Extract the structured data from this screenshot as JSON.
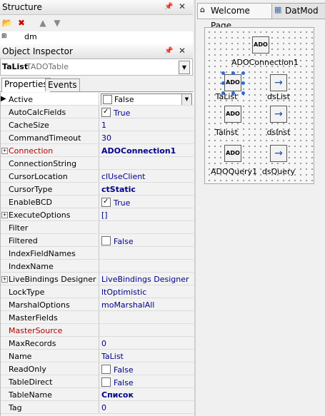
{
  "structure": {
    "title": "Structure",
    "tree_item": "dm"
  },
  "object_inspector": {
    "title": "Object Inspector",
    "selected_name": "TaList",
    "selected_class": "TADOTable",
    "tabs": [
      "Properties",
      "Events"
    ],
    "properties": [
      {
        "name": "Active",
        "value": "False",
        "kind": "combo-check",
        "checked": false
      },
      {
        "name": "AutoCalcFields",
        "value": "True",
        "kind": "check",
        "checked": true
      },
      {
        "name": "CacheSize",
        "value": "1"
      },
      {
        "name": "CommandTimeout",
        "value": "30"
      },
      {
        "name": "Connection",
        "value": "ADOConnection1",
        "expandable": true,
        "name_color": "red",
        "bold_value": true
      },
      {
        "name": "ConnectionString",
        "value": ""
      },
      {
        "name": "CursorLocation",
        "value": "clUseClient"
      },
      {
        "name": "CursorType",
        "value": "ctStatic",
        "bold_value": true
      },
      {
        "name": "EnableBCD",
        "value": "True",
        "kind": "check",
        "checked": true
      },
      {
        "name": "ExecuteOptions",
        "value": "[]",
        "expandable": true
      },
      {
        "name": "Filter",
        "value": ""
      },
      {
        "name": "Filtered",
        "value": "False",
        "kind": "check",
        "checked": false
      },
      {
        "name": "IndexFieldNames",
        "value": ""
      },
      {
        "name": "IndexName",
        "value": ""
      },
      {
        "name": "LiveBindings Designer",
        "value": "LiveBindings Designer",
        "expandable": true
      },
      {
        "name": "LockType",
        "value": "ltOptimistic"
      },
      {
        "name": "MarshalOptions",
        "value": "moMarshalAll"
      },
      {
        "name": "MasterFields",
        "value": ""
      },
      {
        "name": "MasterSource",
        "value": "",
        "name_color": "red"
      },
      {
        "name": "MaxRecords",
        "value": "0"
      },
      {
        "name": "Name",
        "value": "TaList"
      },
      {
        "name": "ReadOnly",
        "value": "False",
        "kind": "check",
        "checked": false
      },
      {
        "name": "TableDirect",
        "value": "False",
        "kind": "check",
        "checked": false
      },
      {
        "name": "TableName",
        "value": "Список",
        "bold_value": true
      },
      {
        "name": "Tag",
        "value": "0"
      }
    ]
  },
  "editor_tabs": [
    "Welcome Page",
    "DatMod"
  ],
  "designer": {
    "components": [
      {
        "id": "adoconn",
        "icon_text": "ADO",
        "caption": "ADOConnection1"
      },
      {
        "id": "talist",
        "icon_text": "ADO",
        "caption": "TaList",
        "selected": true
      },
      {
        "id": "dslist",
        "icon_text": "",
        "caption": "dsList"
      },
      {
        "id": "tainst",
        "icon_text": "ADO",
        "caption": "TaInst"
      },
      {
        "id": "dsinst",
        "icon_text": "",
        "caption": "dsInst"
      },
      {
        "id": "adoquery",
        "icon_text": "ADO",
        "caption": "ADOQuery1"
      },
      {
        "id": "dsquery",
        "icon_text": "",
        "caption": "dsQuery"
      }
    ]
  },
  "colors": {
    "link_value": "#00008b",
    "red_name": "#b00000",
    "selection_handle": "#2a6ad7"
  }
}
